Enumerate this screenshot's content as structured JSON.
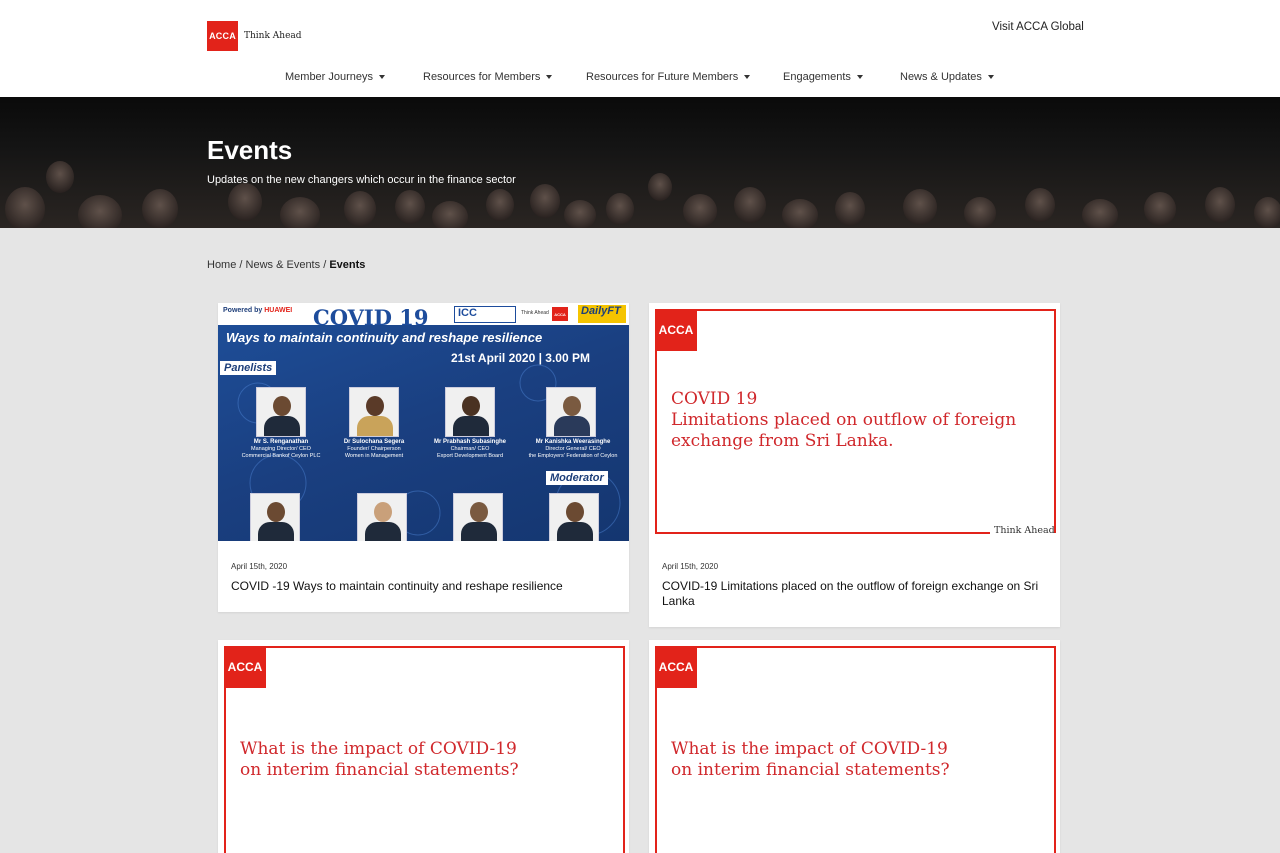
{
  "header": {
    "logo_text": "ACCA",
    "logo_tagline": "Think Ahead",
    "global_link": "Visit ACCA Global",
    "nav": [
      {
        "label": "Member Journeys"
      },
      {
        "label": "Resources for Members"
      },
      {
        "label": "Resources for Future Members"
      },
      {
        "label": "Engagements"
      },
      {
        "label": "News & Updates"
      }
    ]
  },
  "hero": {
    "title": "Events",
    "subtitle": "Updates on the new changers which occur in the finance sector"
  },
  "breadcrumb": {
    "home": "Home",
    "sep": "/",
    "section": "News & Events",
    "current": "Events"
  },
  "cards": [
    {
      "date": "April 15th, 2020",
      "title": "COVID -19 Ways to maintain continuity and reshape resilience",
      "banner": {
        "powered": "Powered by",
        "powered_brand": "HUAWEI",
        "title": "COVID 19",
        "icc": "ICC",
        "think_ahead": "Think Ahead",
        "acca": "ACCA",
        "dailyft": "DailyFT",
        "subtitle": "Ways to maintain continuity and reshape resilience",
        "date": "21st April 2020 | 3.00 PM",
        "panelists_label": "Panelists",
        "moderator_label": "Moderator",
        "panelists": [
          {
            "name": "Mr S. Renganathan",
            "role": "Managing Director/ CEO",
            "org": "Commercial Bankof Ceylon PLC"
          },
          {
            "name": "Dr Sulochana Segera",
            "role": "Founder/ Chairperson",
            "org": "Women in Management"
          },
          {
            "name": "Mr Prabhash Subasinghe",
            "role": "Chairman/ CEO",
            "org": "Export Development Board"
          },
          {
            "name": "Mr Kanishka Weerasinghe",
            "role": "Director General/ CEO",
            "org": "the Employers' Federation of Ceylon"
          }
        ]
      }
    },
    {
      "date": "April 15th, 2020",
      "title": "COVID-19 Limitations placed on the outflow of foreign exchange on Sri Lanka",
      "slide": {
        "logo": "ACCA",
        "line1": "COVID 19",
        "line2": "Limitations placed on outflow of foreign",
        "line3": "exchange from Sri Lanka.",
        "tag": "Think Ahead"
      }
    },
    {
      "slide": {
        "logo": "ACCA",
        "line1": "What is the impact of COVID-19",
        "line2": "on interim financial statements?"
      }
    },
    {
      "slide": {
        "logo": "ACCA",
        "line1": "What is the impact of COVID-19",
        "line2": "on interim financial statements?"
      }
    }
  ],
  "colors": {
    "brand_red": "#e2231a",
    "slide_text": "#d0282c",
    "page_bg": "#e5e5e5"
  }
}
